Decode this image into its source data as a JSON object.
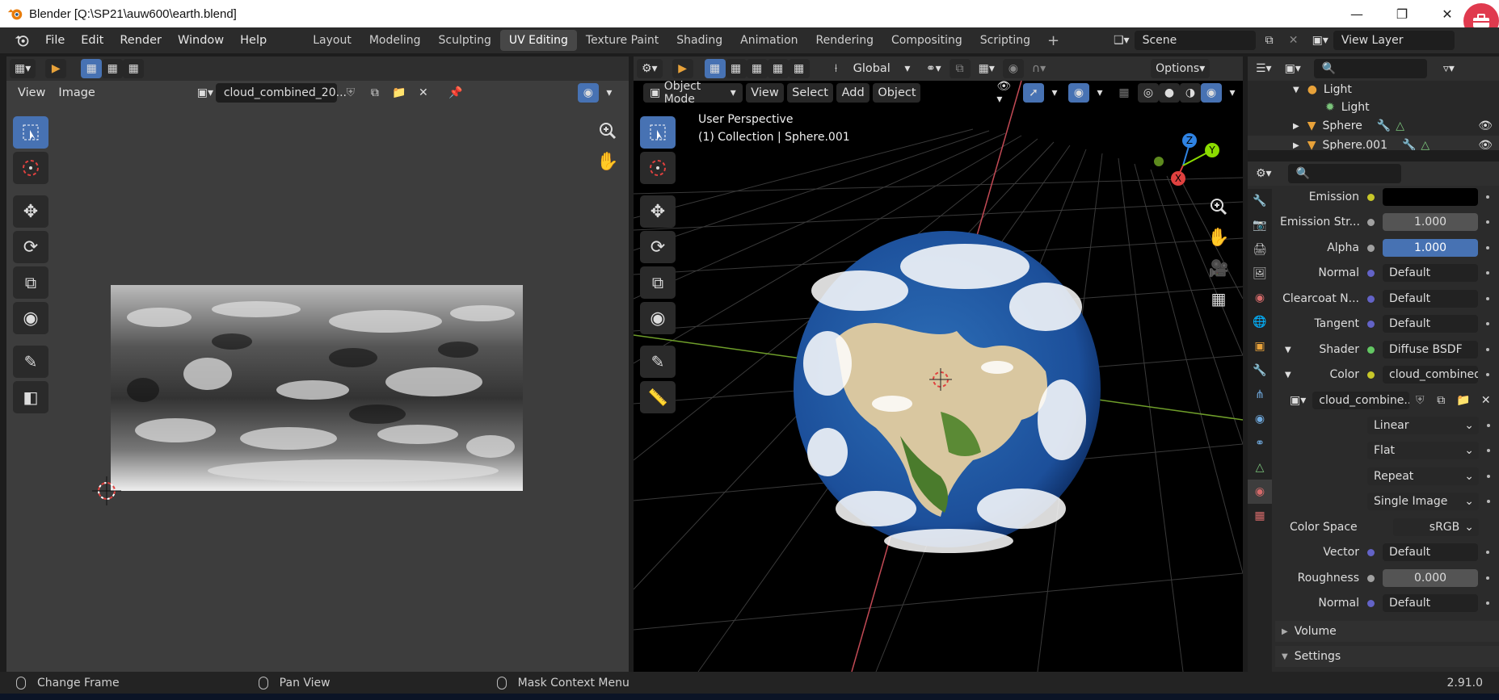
{
  "window": {
    "title": "Blender [Q:\\SP21\\auw600\\earth.blend]"
  },
  "menubar": {
    "items": [
      "File",
      "Edit",
      "Render",
      "Window",
      "Help"
    ],
    "workspace_tabs": [
      "Layout",
      "Modeling",
      "Sculpting",
      "UV Editing",
      "Texture Paint",
      "Shading",
      "Animation",
      "Rendering",
      "Compositing",
      "Scripting"
    ],
    "active_tab": "UV Editing",
    "scene": "Scene",
    "view_layer": "View Layer"
  },
  "uv_editor": {
    "menus": [
      "View",
      "Image"
    ],
    "image_name": "cloud_combined_20..."
  },
  "viewport": {
    "orientation": "Global",
    "options_label": "Options",
    "mode": "Object Mode",
    "menus": [
      "View",
      "Select",
      "Add",
      "Object"
    ],
    "overlay_line1": "User Perspective",
    "overlay_line2": "(1) Collection | Sphere.001",
    "gizmo": {
      "x": "X",
      "y": "Y",
      "z": "Z"
    }
  },
  "outliner": {
    "items": [
      {
        "label": "Light",
        "type": "light-object"
      },
      {
        "label": "Light",
        "type": "light-data"
      },
      {
        "label": "Sphere",
        "type": "mesh"
      },
      {
        "label": "Sphere.001",
        "type": "mesh"
      }
    ]
  },
  "properties": {
    "rows": {
      "emission": {
        "label": "Emission",
        "value": ""
      },
      "emission_strength": {
        "label": "Emission Str...",
        "value": "1.000"
      },
      "alpha": {
        "label": "Alpha",
        "value": "1.000"
      },
      "normal": {
        "label": "Normal",
        "value": "Default"
      },
      "clearcoat_normal": {
        "label": "Clearcoat N...",
        "value": "Default"
      },
      "tangent": {
        "label": "Tangent",
        "value": "Default"
      },
      "shader": {
        "label": "Shader",
        "value": "Diffuse BSDF"
      },
      "color": {
        "label": "Color",
        "value": "cloud_combined_..."
      },
      "image_name": "cloud_combine...",
      "interpolation": "Linear",
      "projection": "Flat",
      "extension": "Repeat",
      "source": "Single Image",
      "color_space": {
        "label": "Color Space",
        "value": "sRGB"
      },
      "vector": {
        "label": "Vector",
        "value": "Default"
      },
      "roughness": {
        "label": "Roughness",
        "value": "0.000"
      },
      "normal2": {
        "label": "Normal",
        "value": "Default"
      },
      "volume": "Volume",
      "settings": "Settings"
    }
  },
  "statusbar": {
    "item1": "Change Frame",
    "item2": "Pan View",
    "item3": "Mask Context Menu",
    "version": "2.91.0"
  },
  "colors": {
    "accent_blue": "#4772b3",
    "axis_x": "#e0413f",
    "axis_y": "#8bdc00",
    "axis_z": "#2f83e3",
    "title_badge": "#e03a4e"
  }
}
